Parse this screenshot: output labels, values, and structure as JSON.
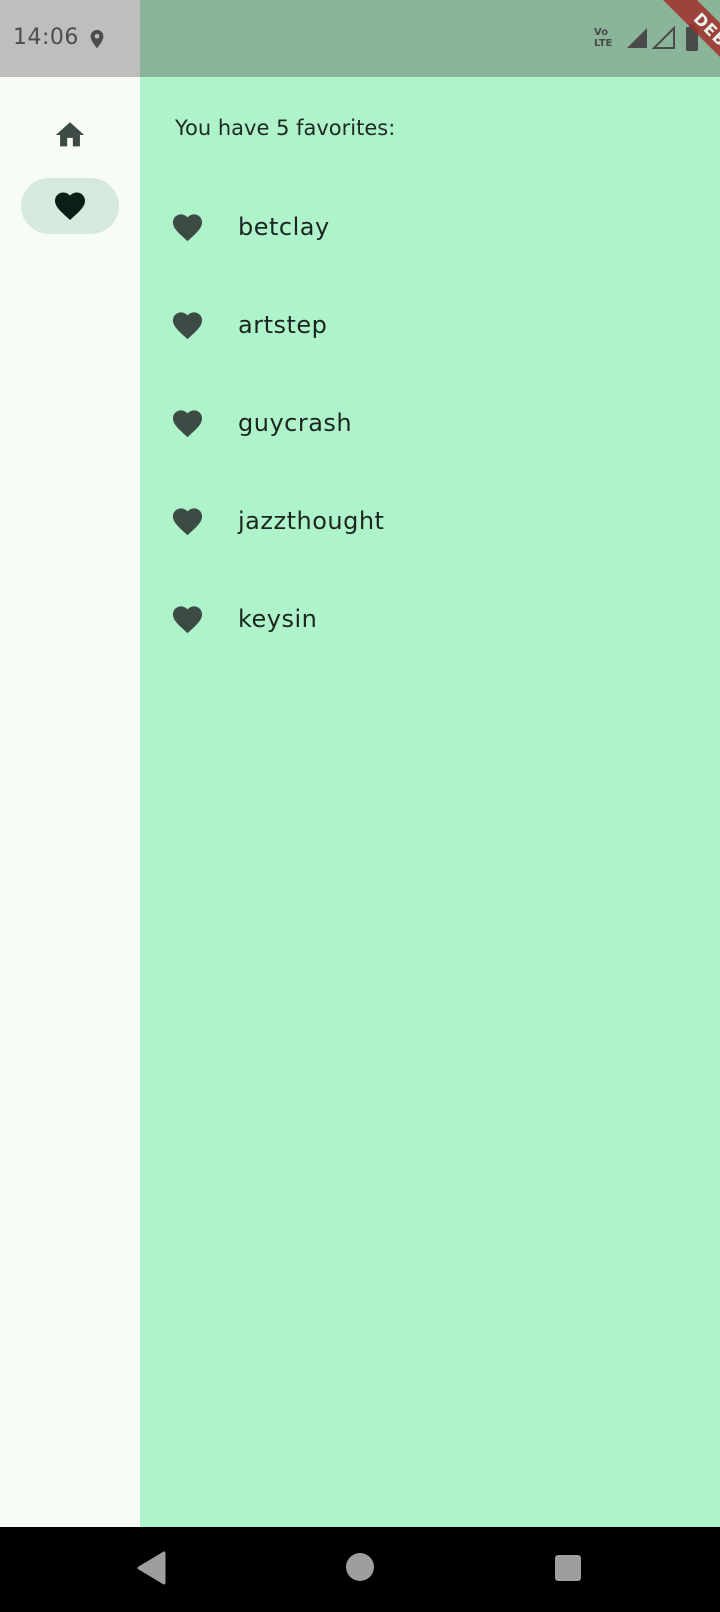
{
  "status_bar": {
    "time": "14:06",
    "network_label_top": "Vo",
    "network_label_bottom": "LTE"
  },
  "debug_banner": {
    "label": "DEBUG"
  },
  "nav_rail": {
    "items": [
      {
        "id": "home",
        "icon": "home-icon",
        "selected": false
      },
      {
        "id": "favorites",
        "icon": "heart-icon",
        "selected": true
      }
    ]
  },
  "favorites": {
    "summary": "You have 5 favorites:",
    "items": [
      {
        "label": "betclay",
        "icon": "heart-icon"
      },
      {
        "label": "artstep",
        "icon": "heart-icon"
      },
      {
        "label": "guycrash",
        "icon": "heart-icon"
      },
      {
        "label": "jazzthought",
        "icon": "heart-icon"
      },
      {
        "label": "keysin",
        "icon": "heart-icon"
      }
    ]
  },
  "system_nav": {
    "buttons": [
      "back",
      "home",
      "recents"
    ]
  },
  "colors": {
    "content_background": "#aef3ca",
    "rail_background": "#f7fcf7",
    "selected_indicator": "#d5e9dd",
    "icon_color": "#3e4b44",
    "status_bar": "#8ab59b",
    "debug_banner": "#a2302c"
  }
}
